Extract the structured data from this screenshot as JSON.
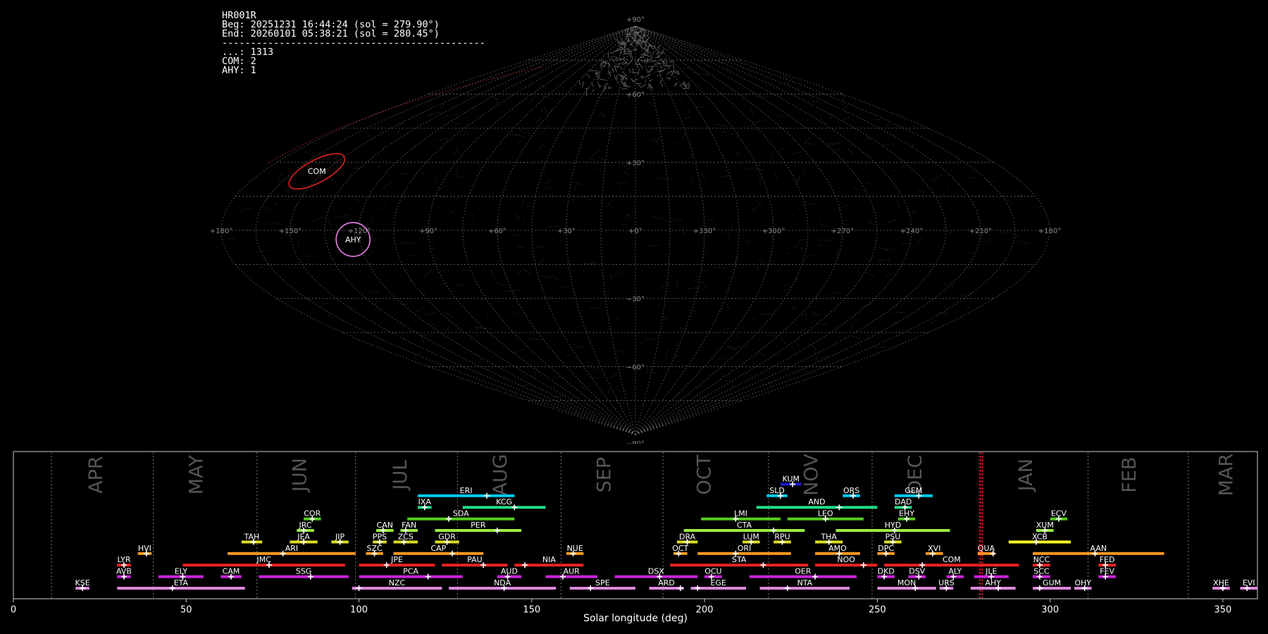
{
  "info": {
    "station": "HR001R",
    "begin": "Beg: 20251231 16:44:24 (sol = 279.90°)",
    "end": "End: 20260101 05:38:21 (sol = 280.45°)",
    "separator": "----------------------------------------------",
    "counts": [
      {
        "code": "...",
        "count": 1313
      },
      {
        "code": "COM",
        "count": 2
      },
      {
        "code": "AHY",
        "count": 1
      }
    ]
  },
  "sky_map": {
    "projection": "sinusoidal",
    "lon_ticks": [
      {
        "label": "+180°",
        "lon": 180
      },
      {
        "label": "+150°",
        "lon": 150
      },
      {
        "label": "+120°",
        "lon": 120
      },
      {
        "label": "+90°",
        "lon": 90
      },
      {
        "label": "+60°",
        "lon": 60
      },
      {
        "label": "+30°",
        "lon": 30
      },
      {
        "label": "+0°",
        "lon": 0
      },
      {
        "label": "+330°",
        "lon": -30
      },
      {
        "label": "+300°",
        "lon": -60
      },
      {
        "label": "+270°",
        "lon": -90
      },
      {
        "label": "+240°",
        "lon": -120
      },
      {
        "label": "+210°",
        "lon": -150
      },
      {
        "label": "+180°",
        "lon": -180
      }
    ],
    "lat_ticks": [
      {
        "label": "+90°",
        "lat": 90
      },
      {
        "label": "+60°",
        "lat": 60
      },
      {
        "label": "+30°",
        "lat": 30
      },
      {
        "label": "−30°",
        "lat": -30
      },
      {
        "label": "−60°",
        "lat": -60
      },
      {
        "label": "−90°",
        "lat": -90
      }
    ],
    "shower_regions": [
      {
        "code": "COM",
        "lon": 154,
        "lat": 26,
        "color": "#dd2222"
      },
      {
        "code": "AHY",
        "lon": 123,
        "lat": -4,
        "color": "#e880e8"
      }
    ],
    "colors": {
      "grid": "#888888",
      "background_meteors": "#aaaaaa"
    }
  },
  "chart_data": {
    "type": "timeline",
    "xlabel": "Solar longitude (deg)",
    "xlim": [
      0,
      360
    ],
    "xticks": [
      0,
      50,
      100,
      150,
      200,
      250,
      300,
      350
    ],
    "month_boundaries": [
      11,
      40.5,
      70.5,
      99,
      128.5,
      158.5,
      188,
      218.5,
      248.5,
      279.5,
      311,
      340
    ],
    "months": [
      {
        "label": "APR",
        "sol": 24
      },
      {
        "label": "MAY",
        "sol": 53
      },
      {
        "label": "JUN",
        "sol": 83
      },
      {
        "label": "JUL",
        "sol": 112
      },
      {
        "label": "AUG",
        "sol": 141
      },
      {
        "label": "SEP",
        "sol": 171
      },
      {
        "label": "OCT",
        "sol": 200
      },
      {
        "label": "NOV",
        "sol": 231
      },
      {
        "label": "DEC",
        "sol": 261
      },
      {
        "label": "JAN",
        "sol": 293
      },
      {
        "label": "FEB",
        "sol": 323
      },
      {
        "label": "MAR",
        "sol": 351
      }
    ],
    "current_sol": [
      279.9,
      280.45
    ],
    "showers": [
      {
        "code": "KUM",
        "start": 222,
        "end": 228,
        "peak": 225.5,
        "row": 10,
        "color": "#1a1acc"
      },
      {
        "code": "ERI",
        "start": 117,
        "end": 145,
        "peak": 137,
        "row": 9,
        "color": "#00ccee"
      },
      {
        "code": "SLD",
        "start": 218,
        "end": 224,
        "peak": 222,
        "row": 9,
        "color": "#00ccee"
      },
      {
        "code": "ORS",
        "start": 240,
        "end": 245,
        "peak": 243,
        "row": 9,
        "color": "#00ccee"
      },
      {
        "code": "GEM",
        "start": 255,
        "end": 266,
        "peak": 262,
        "row": 9,
        "color": "#00ccee"
      },
      {
        "code": "IXA",
        "start": 117,
        "end": 121,
        "peak": 119,
        "row": 8,
        "color": "#22dd88"
      },
      {
        "code": "KCG",
        "start": 130,
        "end": 154,
        "peak": 145,
        "row": 8,
        "color": "#22dd88"
      },
      {
        "code": "AND",
        "start": 215,
        "end": 250,
        "peak": 239,
        "row": 8,
        "color": "#22dd88"
      },
      {
        "code": "DAD",
        "start": 255,
        "end": 260,
        "peak": 258,
        "row": 8,
        "color": "#22dd88"
      },
      {
        "code": "COR",
        "start": 84,
        "end": 89,
        "peak": 86.5,
        "row": 7,
        "color": "#55cc22"
      },
      {
        "code": "SDA",
        "start": 114,
        "end": 145,
        "peak": 126,
        "row": 7,
        "color": "#55cc22"
      },
      {
        "code": "LMI",
        "start": 199,
        "end": 222,
        "peak": 209,
        "row": 7,
        "color": "#55cc22"
      },
      {
        "code": "LEO",
        "start": 224,
        "end": 246,
        "peak": 235,
        "row": 7,
        "color": "#55cc22"
      },
      {
        "code": "EHY",
        "start": 256,
        "end": 261,
        "peak": 258.5,
        "row": 7,
        "color": "#55cc22"
      },
      {
        "code": "ECV",
        "start": 300,
        "end": 305,
        "peak": 302.5,
        "row": 7,
        "color": "#55cc22"
      },
      {
        "code": "JRC",
        "start": 82,
        "end": 87,
        "peak": 84,
        "row": 6,
        "color": "#99ee44"
      },
      {
        "code": "CAN",
        "start": 105,
        "end": 110,
        "peak": 107,
        "row": 6,
        "color": "#99ee44"
      },
      {
        "code": "FAN",
        "start": 112,
        "end": 117,
        "peak": 113.5,
        "row": 6,
        "color": "#99ee44"
      },
      {
        "code": "PER",
        "start": 122,
        "end": 147,
        "peak": 140,
        "row": 6,
        "color": "#99ee44"
      },
      {
        "code": "CTA",
        "start": 194,
        "end": 229,
        "peak": 220,
        "row": 6,
        "color": "#99ee44"
      },
      {
        "code": "HYD",
        "start": 238,
        "end": 271,
        "peak": 255,
        "row": 6,
        "color": "#99ee44"
      },
      {
        "code": "XUM",
        "start": 296,
        "end": 301,
        "peak": 298.5,
        "row": 6,
        "color": "#99ee44"
      },
      {
        "code": "TAH",
        "start": 66,
        "end": 72,
        "peak": 69.5,
        "row": 5,
        "color": "#dddd22"
      },
      {
        "code": "JEA",
        "start": 80,
        "end": 88,
        "peak": 84,
        "row": 5,
        "color": "#dddd22"
      },
      {
        "code": "JIP",
        "start": 92,
        "end": 97,
        "peak": 94.5,
        "row": 5,
        "color": "#dddd22"
      },
      {
        "code": "PPS",
        "start": 104,
        "end": 108,
        "peak": 106,
        "row": 5,
        "color": "#dddd22"
      },
      {
        "code": "ZCS",
        "start": 110,
        "end": 117,
        "peak": 113,
        "row": 5,
        "color": "#dddd22"
      },
      {
        "code": "GDR",
        "start": 122,
        "end": 129,
        "peak": 125.5,
        "row": 5,
        "color": "#dddd22"
      },
      {
        "code": "DRA",
        "start": 192,
        "end": 198,
        "peak": 195,
        "row": 5,
        "color": "#dddd22"
      },
      {
        "code": "LUM",
        "start": 211,
        "end": 216,
        "peak": 213.5,
        "row": 5,
        "color": "#dddd22"
      },
      {
        "code": "RPU",
        "start": 220,
        "end": 225,
        "peak": 222.5,
        "row": 5,
        "color": "#dddd22"
      },
      {
        "code": "THA",
        "start": 232,
        "end": 240,
        "peak": 236,
        "row": 5,
        "color": "#dddd22"
      },
      {
        "code": "PSU",
        "start": 252,
        "end": 257,
        "peak": 254.5,
        "row": 5,
        "color": "#dddd22"
      },
      {
        "code": "XCB",
        "start": 288,
        "end": 306,
        "peak": 296,
        "row": 5,
        "color": "#ffff22"
      },
      {
        "code": "HVI",
        "start": 36,
        "end": 40,
        "peak": 38.5,
        "row": 4,
        "color": "#ff9922"
      },
      {
        "code": "ARI",
        "start": 62,
        "end": 99,
        "peak": 78,
        "row": 4,
        "color": "#ff9922"
      },
      {
        "code": "SZC",
        "start": 102,
        "end": 107,
        "peak": 104.5,
        "row": 4,
        "color": "#ff9922"
      },
      {
        "code": "CAP",
        "start": 110,
        "end": 136,
        "peak": 127,
        "row": 4,
        "color": "#ff9922"
      },
      {
        "code": "NUE",
        "start": 160,
        "end": 165,
        "peak": 162,
        "row": 4,
        "color": "#ff9922"
      },
      {
        "code": "OCT",
        "start": 191,
        "end": 195,
        "peak": 192.5,
        "row": 4,
        "color": "#ff9922"
      },
      {
        "code": "ORI",
        "start": 198,
        "end": 225,
        "peak": 209,
        "row": 4,
        "color": "#ff9922"
      },
      {
        "code": "AMO",
        "start": 232,
        "end": 245,
        "peak": 239,
        "row": 4,
        "color": "#ff9922"
      },
      {
        "code": "DPC",
        "start": 250,
        "end": 255,
        "peak": 252.5,
        "row": 4,
        "color": "#ff9922"
      },
      {
        "code": "XVI",
        "start": 264,
        "end": 269,
        "peak": 266,
        "row": 4,
        "color": "#ff9922"
      },
      {
        "code": "QUA",
        "start": 279,
        "end": 284,
        "peak": 283.5,
        "row": 4,
        "color": "#ff9922"
      },
      {
        "code": "AAN",
        "start": 295,
        "end": 333,
        "peak": 313,
        "row": 4,
        "color": "#ff9922"
      },
      {
        "code": "LYR",
        "start": 30,
        "end": 34,
        "peak": 32,
        "row": 3,
        "color": "#ee2222"
      },
      {
        "code": "JMC",
        "start": 49,
        "end": 96,
        "peak": 74,
        "row": 3,
        "color": "#ee2222"
      },
      {
        "code": "JPE",
        "start": 100,
        "end": 122,
        "peak": 108,
        "row": 3,
        "color": "#ee2222"
      },
      {
        "code": "PAU",
        "start": 124,
        "end": 143,
        "peak": 136,
        "row": 3,
        "color": "#ee2222"
      },
      {
        "code": "NIA",
        "start": 145,
        "end": 165,
        "peak": 148,
        "row": 3,
        "color": "#ee2222"
      },
      {
        "code": "STA",
        "start": 190,
        "end": 230,
        "peak": 217,
        "row": 3,
        "color": "#ee2222"
      },
      {
        "code": "NOO",
        "start": 232,
        "end": 250,
        "peak": 246,
        "row": 3,
        "color": "#ee2222"
      },
      {
        "code": "COM",
        "start": 252,
        "end": 291,
        "peak": 263,
        "row": 3,
        "color": "#ee2222"
      },
      {
        "code": "NCC",
        "start": 295,
        "end": 300,
        "peak": 297,
        "row": 3,
        "color": "#ee2222"
      },
      {
        "code": "FED",
        "start": 314,
        "end": 319,
        "peak": 316,
        "row": 3,
        "color": "#ee2222"
      },
      {
        "code": "AVB",
        "start": 30,
        "end": 34,
        "peak": 32,
        "row": 2,
        "color": "#cc22dd"
      },
      {
        "code": "ELY",
        "start": 42,
        "end": 55,
        "peak": 49,
        "row": 2,
        "color": "#cc22dd"
      },
      {
        "code": "CAM",
        "start": 60,
        "end": 66,
        "peak": 63,
        "row": 2,
        "color": "#cc22dd"
      },
      {
        "code": "SSG",
        "start": 71,
        "end": 97,
        "peak": 86,
        "row": 2,
        "color": "#cc22dd"
      },
      {
        "code": "PCA",
        "start": 100,
        "end": 130,
        "peak": 120,
        "row": 2,
        "color": "#cc22dd"
      },
      {
        "code": "AUD",
        "start": 140,
        "end": 147,
        "peak": 143,
        "row": 2,
        "color": "#cc22dd"
      },
      {
        "code": "AUR",
        "start": 154,
        "end": 169,
        "peak": 159,
        "row": 2,
        "color": "#cc22dd"
      },
      {
        "code": "DSX",
        "start": 174,
        "end": 198,
        "peak": 187,
        "row": 2,
        "color": "#cc22dd"
      },
      {
        "code": "OCU",
        "start": 200,
        "end": 205,
        "peak": 202,
        "row": 2,
        "color": "#cc22dd"
      },
      {
        "code": "OER",
        "start": 213,
        "end": 244,
        "peak": 232,
        "row": 2,
        "color": "#cc22dd"
      },
      {
        "code": "DKD",
        "start": 250,
        "end": 255,
        "peak": 252,
        "row": 2,
        "color": "#cc22dd"
      },
      {
        "code": "DSV",
        "start": 259,
        "end": 264,
        "peak": 262,
        "row": 2,
        "color": "#cc22dd"
      },
      {
        "code": "ALY",
        "start": 270,
        "end": 275,
        "peak": 272,
        "row": 2,
        "color": "#cc22dd"
      },
      {
        "code": "JLE",
        "start": 278,
        "end": 288,
        "peak": 283,
        "row": 2,
        "color": "#cc22dd"
      },
      {
        "code": "SCC",
        "start": 295,
        "end": 300,
        "peak": 297,
        "row": 2,
        "color": "#cc22dd"
      },
      {
        "code": "FEV",
        "start": 314,
        "end": 319,
        "peak": 316,
        "row": 2,
        "color": "#cc22dd"
      },
      {
        "code": "KSE",
        "start": 18,
        "end": 22,
        "peak": 20,
        "row": 1,
        "color": "#dd88dd"
      },
      {
        "code": "ETA",
        "start": 30,
        "end": 67,
        "peak": 46,
        "row": 1,
        "color": "#dd88dd"
      },
      {
        "code": "NZC",
        "start": 98,
        "end": 124,
        "peak": 100,
        "row": 1,
        "color": "#dd88dd"
      },
      {
        "code": "NDA",
        "start": 126,
        "end": 157,
        "peak": 142,
        "row": 1,
        "color": "#dd88dd"
      },
      {
        "code": "SPE",
        "start": 161,
        "end": 180,
        "peak": 167,
        "row": 1,
        "color": "#dd88dd"
      },
      {
        "code": "ARD",
        "start": 184,
        "end": 194,
        "peak": 193,
        "row": 1,
        "color": "#dd88dd"
      },
      {
        "code": "EGE",
        "start": 196,
        "end": 212,
        "peak": 198,
        "row": 1,
        "color": "#dd88dd"
      },
      {
        "code": "NTA",
        "start": 216,
        "end": 242,
        "peak": 224,
        "row": 1,
        "color": "#dd88dd"
      },
      {
        "code": "MON",
        "start": 250,
        "end": 267,
        "peak": 261,
        "row": 1,
        "color": "#dd88dd"
      },
      {
        "code": "URS",
        "start": 268,
        "end": 272,
        "peak": 270,
        "row": 1,
        "color": "#dd88dd"
      },
      {
        "code": "AHY",
        "start": 277,
        "end": 290,
        "peak": 285,
        "row": 1,
        "color": "#dd88dd"
      },
      {
        "code": "GUM",
        "start": 295,
        "end": 306,
        "peak": 297,
        "row": 1,
        "color": "#dd88dd"
      },
      {
        "code": "OHY",
        "start": 307,
        "end": 312,
        "peak": 310,
        "row": 1,
        "color": "#dd88dd"
      },
      {
        "code": "XHE",
        "start": 347,
        "end": 352,
        "peak": 350,
        "row": 1,
        "color": "#dd88dd"
      },
      {
        "code": "EVI",
        "start": 355,
        "end": 360,
        "peak": 357,
        "row": 1,
        "color": "#dd88dd"
      }
    ]
  }
}
